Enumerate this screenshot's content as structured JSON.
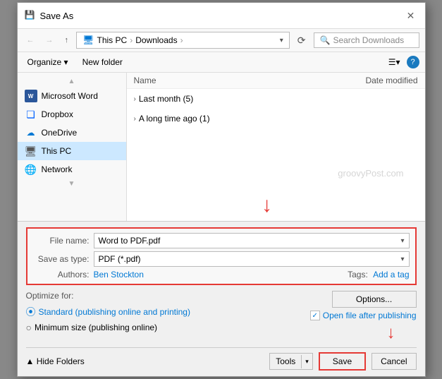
{
  "dialog": {
    "title": "Save As",
    "icon": "💾"
  },
  "toolbar": {
    "back_btn": "←",
    "forward_btn": "→",
    "up_btn": "↑",
    "address": {
      "parts": [
        "This PC",
        "Downloads"
      ],
      "separator": "›"
    },
    "refresh_btn": "⟳",
    "search_placeholder": "Search Downloads"
  },
  "action_bar": {
    "organize_label": "Organize ▾",
    "new_folder_label": "New folder",
    "view_icon": "☰",
    "help_label": "?"
  },
  "sidebar": {
    "items": [
      {
        "id": "microsoft-word",
        "label": "Microsoft Word",
        "icon": "W"
      },
      {
        "id": "dropbox",
        "label": "Dropbox",
        "icon": "❏"
      },
      {
        "id": "onedrive",
        "label": "OneDrive",
        "icon": "☁"
      },
      {
        "id": "this-pc",
        "label": "This PC",
        "icon": "🖥"
      },
      {
        "id": "network",
        "label": "Network",
        "icon": "🌐"
      }
    ]
  },
  "file_list": {
    "header_name": "Name",
    "header_date": "Date modified",
    "groups": [
      {
        "id": "last-month",
        "label": "Last month (5)"
      },
      {
        "id": "long-ago",
        "label": "A long time ago (1)"
      }
    ]
  },
  "watermark": "groovyPost.com",
  "fields": {
    "filename_label": "File name:",
    "filename_value": "Word to PDF.pdf",
    "savetype_label": "Save as type:",
    "savetype_value": "PDF (*.pdf)",
    "authors_label": "Authors:",
    "authors_value": "Ben Stockton",
    "tags_label": "Tags:",
    "tags_value": "Add a tag"
  },
  "optimize": {
    "label": "Optimize for:",
    "option1_label": "Standard (publishing online and printing)",
    "option2_label": "Minimum size (publishing online)"
  },
  "buttons": {
    "options_label": "Options...",
    "open_after_label": "Open file after publishing",
    "tools_label": "Tools",
    "tools_arrow": "▾",
    "save_label": "Save",
    "cancel_label": "Cancel"
  },
  "bottom": {
    "hide_folders_label": "▲ Hide Folders"
  }
}
